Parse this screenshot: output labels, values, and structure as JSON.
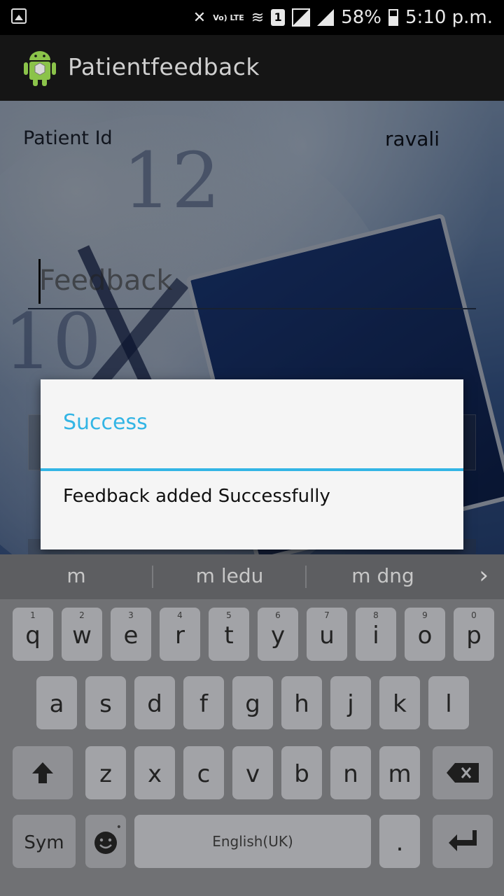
{
  "status_bar": {
    "battery": "58%",
    "time": "5:10 p.m.",
    "network": "Vo) LTE",
    "sim": "1"
  },
  "app": {
    "title": "Patientfeedback"
  },
  "form": {
    "patient_id_label": "Patient Id",
    "patient_id_value": "ravali",
    "feedback_placeholder": "Feedback",
    "feedback_value": ""
  },
  "dialog": {
    "title": "Success",
    "message": "Feedback added Successfully"
  },
  "colors": {
    "dialog_accent": "#33b5e5"
  },
  "keyboard": {
    "suggestions": [
      "m",
      "m ledu",
      "m dng"
    ],
    "row1": [
      {
        "char": "q",
        "num": "1"
      },
      {
        "char": "w",
        "num": "2"
      },
      {
        "char": "e",
        "num": "3"
      },
      {
        "char": "r",
        "num": "4"
      },
      {
        "char": "t",
        "num": "5"
      },
      {
        "char": "y",
        "num": "6"
      },
      {
        "char": "u",
        "num": "7"
      },
      {
        "char": "i",
        "num": "8"
      },
      {
        "char": "o",
        "num": "9"
      },
      {
        "char": "p",
        "num": "0"
      }
    ],
    "row2": [
      "a",
      "s",
      "d",
      "f",
      "g",
      "h",
      "j",
      "k",
      "l"
    ],
    "row3": [
      "z",
      "x",
      "c",
      "v",
      "b",
      "n",
      "m"
    ],
    "sym_label": "Sym",
    "space_label": "English(UK)",
    "period": "."
  }
}
